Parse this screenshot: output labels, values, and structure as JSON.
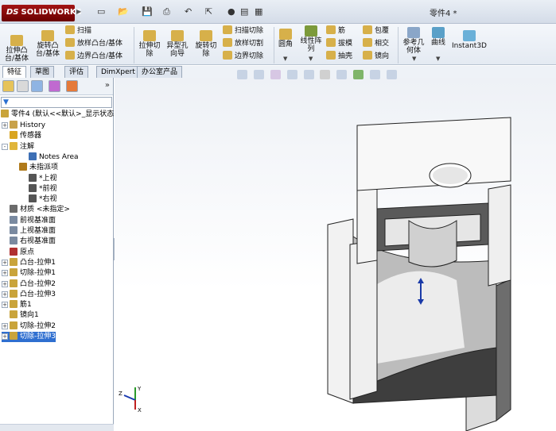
{
  "app": {
    "logo": "SOLIDWORKS",
    "logo_mark": "DS",
    "document_title": "零件4 *"
  },
  "ribbon": {
    "extrude_boss": "拉伸凸\n台/基体",
    "revolve_boss": "旋转凸\n台/基体",
    "sweep": "扫描",
    "loft": "放样凸台/基体",
    "boundary_boss": "边界凸台/基体",
    "extruded_cut": "拉伸切\n除",
    "hole_wizard": "异型孔\n向导",
    "revolved_cut": "旋转切\n除",
    "swept_cut": "扫描切除",
    "lofted_cut": "放样切割",
    "boundary_cut": "边界切除",
    "fillet": "圆角",
    "linear_pattern": "线性阵\n列",
    "rib": "筋",
    "draft": "拔模",
    "shell": "抽壳",
    "wrap": "包覆",
    "intersect": "相交",
    "mirror": "镜向",
    "ref_geometry": "参考几\n何体",
    "curves": "曲线",
    "instant3d": "Instant3D"
  },
  "tabs": [
    "特征",
    "草图",
    "评估",
    "DimXpert",
    "办公室产品"
  ],
  "tree": {
    "root": "零件4 (默认<<默认>_显示状态",
    "items": [
      {
        "label": "History",
        "depth": 0,
        "expander": "+",
        "icon": "history-icon",
        "color": "#c8a24a"
      },
      {
        "label": "传感器",
        "depth": 0,
        "expander": "",
        "icon": "sensor-icon",
        "color": "#d9a520"
      },
      {
        "label": "注解",
        "depth": 0,
        "expander": "-",
        "icon": "annotation-icon",
        "color": "#e0b53a"
      },
      {
        "label": "Notes Area",
        "depth": 2,
        "expander": "",
        "icon": "notes-area-icon",
        "color": "#3d6fb5"
      },
      {
        "label": "未指派项",
        "depth": 1,
        "expander": "",
        "icon": "arrow-icon",
        "color": "#b07a1a"
      },
      {
        "label": "*上视",
        "depth": 2,
        "expander": "",
        "icon": "view-icon",
        "color": "#555"
      },
      {
        "label": "*前视",
        "depth": 2,
        "expander": "",
        "icon": "view-icon",
        "color": "#555"
      },
      {
        "label": "*右视",
        "depth": 2,
        "expander": "",
        "icon": "view-icon",
        "color": "#555"
      },
      {
        "label": "材质 <未指定>",
        "depth": 0,
        "expander": "",
        "icon": "material-icon",
        "color": "#6b6b6b"
      },
      {
        "label": "前视基准面",
        "depth": 0,
        "expander": "",
        "icon": "plane-icon",
        "color": "#7a8aa0"
      },
      {
        "label": "上视基准面",
        "depth": 0,
        "expander": "",
        "icon": "plane-icon",
        "color": "#7a8aa0"
      },
      {
        "label": "右视基准面",
        "depth": 0,
        "expander": "",
        "icon": "plane-icon",
        "color": "#7a8aa0"
      },
      {
        "label": "原点",
        "depth": 0,
        "expander": "",
        "icon": "origin-icon",
        "color": "#b03030"
      },
      {
        "label": "凸台-拉伸1",
        "depth": 0,
        "expander": "+",
        "icon": "boss-extrude-icon",
        "color": "#c9a43b"
      },
      {
        "label": "切除-拉伸1",
        "depth": 0,
        "expander": "+",
        "icon": "cut-extrude-icon",
        "color": "#c9a43b"
      },
      {
        "label": "凸台-拉伸2",
        "depth": 0,
        "expander": "+",
        "icon": "boss-extrude-icon",
        "color": "#c9a43b"
      },
      {
        "label": "凸台-拉伸3",
        "depth": 0,
        "expander": "+",
        "icon": "boss-extrude-icon",
        "color": "#c9a43b"
      },
      {
        "label": "筋1",
        "depth": 0,
        "expander": "+",
        "icon": "rib-icon",
        "color": "#c9a43b"
      },
      {
        "label": "镜向1",
        "depth": 0,
        "expander": "",
        "icon": "mirror-icon",
        "color": "#c9a43b"
      },
      {
        "label": "切除-拉伸2",
        "depth": 0,
        "expander": "+",
        "icon": "cut-extrude-icon",
        "color": "#c9a43b"
      },
      {
        "label": "切除-拉伸3",
        "depth": 0,
        "expander": "+",
        "icon": "cut-extrude-icon",
        "color": "#c9a43b",
        "selected": true
      }
    ]
  },
  "triad": {
    "x": "X",
    "y": "Y",
    "z": "Z"
  },
  "colors": {
    "accent": "#2f6fd0",
    "model_face": "#f4f4f4",
    "model_shadow": "#5a5a5a"
  }
}
